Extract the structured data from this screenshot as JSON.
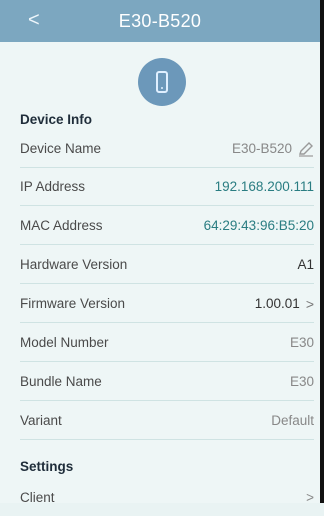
{
  "header": {
    "back_label": "<",
    "title": "E30-B520"
  },
  "sections": {
    "device_info": "Device Info",
    "settings": "Settings"
  },
  "rows": [
    {
      "label": "Device Name",
      "value": "E30-B520"
    },
    {
      "label": "IP Address",
      "value": "192.168.200.111"
    },
    {
      "label": "MAC Address",
      "value": "64:29:43:96:B5:20"
    },
    {
      "label": "Hardware Version",
      "value": "A1"
    },
    {
      "label": "Firmware Version",
      "value": "1.00.01"
    },
    {
      "label": "Model Number",
      "value": "E30"
    },
    {
      "label": "Bundle Name",
      "value": "E30"
    },
    {
      "label": "Variant",
      "value": "Default"
    }
  ],
  "settings_rows": [
    {
      "label": "Client",
      "value": ">"
    }
  ],
  "colors": {
    "header": "#7ca7c0",
    "accent": "#2a7d82"
  },
  "icons": {
    "back": "chevron-left-icon",
    "device": "device-icon",
    "edit": "pencil-icon",
    "firmware": "chevron-right-icon"
  }
}
